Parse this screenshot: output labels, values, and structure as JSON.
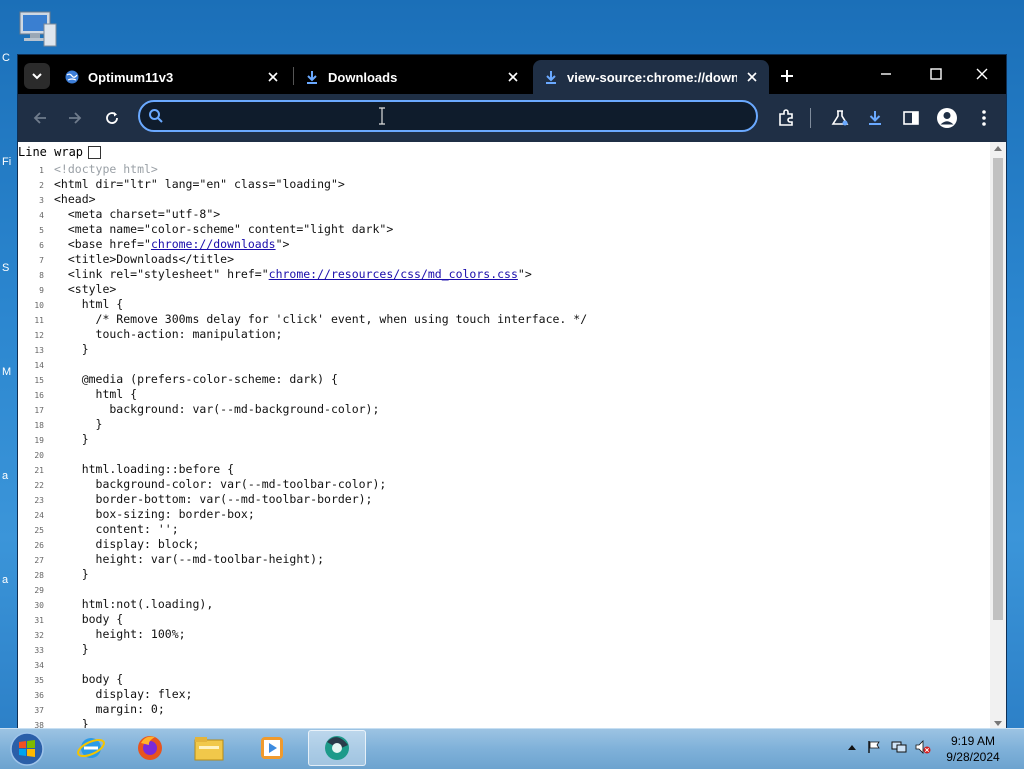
{
  "desktop": {
    "icon_name": "computer-icon",
    "edge_letters": [
      "C",
      "Fi",
      "S",
      "M",
      "a",
      "a"
    ]
  },
  "browser": {
    "tabs": [
      {
        "title": "Optimum11v3",
        "icon": "globe-icon"
      },
      {
        "title": "Downloads",
        "icon": "download-icon"
      },
      {
        "title": "view-source:chrome://downloads",
        "icon": "download-icon",
        "active": true
      }
    ],
    "omnibox": {
      "value": "",
      "placeholder": ""
    },
    "line_wrap_label": "Line wrap",
    "line_wrap_checked": false,
    "source_lines": [
      {
        "n": "1",
        "t": "<!doctype html>"
      },
      {
        "n": "2",
        "t": "<html dir=\"ltr\" lang=\"en\" class=\"loading\">"
      },
      {
        "n": "3",
        "t": "<head>"
      },
      {
        "n": "4",
        "t": "  <meta charset=\"utf-8\">"
      },
      {
        "n": "5",
        "t": "  <meta name=\"color-scheme\" content=\"light dark\">"
      },
      {
        "n": "6",
        "t": "  <base href=\"",
        "link": "chrome://downloads",
        "after": "\">"
      },
      {
        "n": "7",
        "t": "  <title>Downloads</title>"
      },
      {
        "n": "8",
        "t": "  <link rel=\"stylesheet\" href=\"",
        "link": "chrome://resources/css/md_colors.css",
        "after": "\">"
      },
      {
        "n": "9",
        "t": "  <style>"
      },
      {
        "n": "10",
        "t": "    html {"
      },
      {
        "n": "11",
        "t": "      /* Remove 300ms delay for 'click' event, when using touch interface. */"
      },
      {
        "n": "12",
        "t": "      touch-action: manipulation;"
      },
      {
        "n": "13",
        "t": "    }"
      },
      {
        "n": "14",
        "t": ""
      },
      {
        "n": "15",
        "t": "    @media (prefers-color-scheme: dark) {"
      },
      {
        "n": "16",
        "t": "      html {"
      },
      {
        "n": "17",
        "t": "        background: var(--md-background-color);"
      },
      {
        "n": "18",
        "t": "      }"
      },
      {
        "n": "19",
        "t": "    }"
      },
      {
        "n": "20",
        "t": ""
      },
      {
        "n": "21",
        "t": "    html.loading::before {"
      },
      {
        "n": "22",
        "t": "      background-color: var(--md-toolbar-color);"
      },
      {
        "n": "23",
        "t": "      border-bottom: var(--md-toolbar-border);"
      },
      {
        "n": "24",
        "t": "      box-sizing: border-box;"
      },
      {
        "n": "25",
        "t": "      content: '';"
      },
      {
        "n": "26",
        "t": "      display: block;"
      },
      {
        "n": "27",
        "t": "      height: var(--md-toolbar-height);"
      },
      {
        "n": "28",
        "t": "    }"
      },
      {
        "n": "29",
        "t": ""
      },
      {
        "n": "30",
        "t": "    html:not(.loading),"
      },
      {
        "n": "31",
        "t": "    body {"
      },
      {
        "n": "32",
        "t": "      height: 100%;"
      },
      {
        "n": "33",
        "t": "    }"
      },
      {
        "n": "34",
        "t": ""
      },
      {
        "n": "35",
        "t": "    body {"
      },
      {
        "n": "36",
        "t": "      display: flex;"
      },
      {
        "n": "37",
        "t": "      margin: 0;"
      },
      {
        "n": "38",
        "t": "    }"
      }
    ]
  },
  "taskbar": {
    "apps": [
      {
        "name": "internet-explorer-icon"
      },
      {
        "name": "firefox-icon"
      },
      {
        "name": "file-explorer-icon"
      },
      {
        "name": "media-player-icon"
      },
      {
        "name": "chrome-app-icon",
        "active": true
      }
    ],
    "clock": {
      "time": "9:19 AM",
      "date": "9/28/2024"
    }
  },
  "colors": {
    "tab_active_bg": "#1f2f45",
    "toolbar_bg": "#1f2f45",
    "omnibox_border": "#6aa9ff",
    "link": "#1a0dab"
  }
}
